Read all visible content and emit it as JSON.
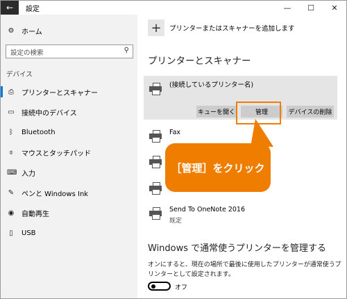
{
  "window": {
    "title": "設定",
    "back_icon": "←",
    "minimize": "—",
    "maximize": "☐",
    "close": "✕"
  },
  "sidebar": {
    "home_label": "ホーム",
    "search_placeholder": "設定の検索",
    "section_label": "デバイス",
    "items": [
      {
        "label": "プリンターとスキャナー",
        "icon": "printer-icon"
      },
      {
        "label": "接続中のデバイス",
        "icon": "devices-icon"
      },
      {
        "label": "Bluetooth",
        "icon": "bluetooth-icon"
      },
      {
        "label": "マウスとタッチパッド",
        "icon": "mouse-icon"
      },
      {
        "label": "入力",
        "icon": "keyboard-icon"
      },
      {
        "label": "ペンと Windows Ink",
        "icon": "pen-icon"
      },
      {
        "label": "自動再生",
        "icon": "autoplay-icon"
      },
      {
        "label": "USB",
        "icon": "usb-icon"
      }
    ],
    "accent": "#0078d7"
  },
  "main": {
    "add_label": "プリンターまたはスキャナーを追加します",
    "section_title": "プリンターとスキャナー",
    "selected_printer": "(接続しているプリンター名)",
    "buttons": {
      "queue": "キューを開く",
      "manage": "管理",
      "remove": "デバイスの削除"
    },
    "printers": [
      {
        "name": "Fax",
        "sub": ""
      },
      {
        "name": "",
        "sub": ""
      },
      {
        "name": "",
        "sub": ""
      },
      {
        "name": "Send To OneNote 2016",
        "sub": "既定"
      }
    ],
    "windows_section_title": "Windows で通常使うプリンターを管理する",
    "windows_section_desc": "オンにすると、現在の場所で最後に使用したプリンターが通常使うプリンターとして設定されます。",
    "toggle_label": "オフ",
    "toggle_state": "off"
  },
  "callout": {
    "text": "［管理］をクリック",
    "color": "#ef7d00"
  }
}
